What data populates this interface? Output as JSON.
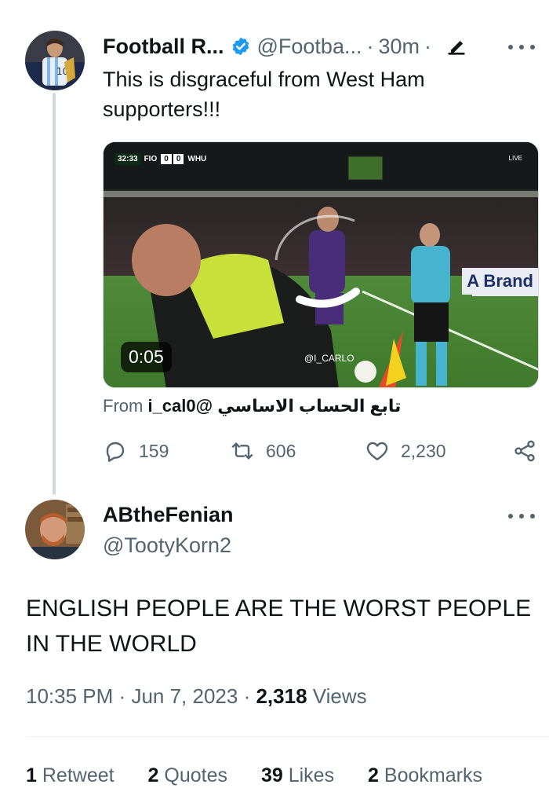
{
  "quoted_tweet": {
    "display_name": "Football R...",
    "handle": "@Footba...",
    "separator": "·",
    "time": "30m",
    "text": "This is disgraceful from West Ham supporters!!!",
    "video": {
      "duration": "0:05",
      "scoreboard": {
        "clock": "32:33",
        "home": "FIO",
        "home_score": "0",
        "away_score": "0",
        "away": "WHU"
      },
      "watermark": "@I_CARLO",
      "broadcaster": "LIVE",
      "board_text": "A Brand"
    },
    "from_label": "From",
    "from_source": "تابع الحساب الاساسي @i_cal0",
    "actions": {
      "replies": "159",
      "retweets": "606",
      "likes": "2,230"
    }
  },
  "main_tweet": {
    "display_name": "ABtheFenian",
    "handle": "@TootyKorn2",
    "text": "ENGLISH PEOPLE ARE THE WORST PEOPLE IN THE WORLD",
    "time": "10:35 PM",
    "date": "Jun 7, 2023",
    "separator": "·",
    "views_count": "2,318",
    "views_label": "Views",
    "stats": [
      {
        "count": "1",
        "label": "Retweet"
      },
      {
        "count": "2",
        "label": "Quotes"
      },
      {
        "count": "39",
        "label": "Likes"
      },
      {
        "count": "2",
        "label": "Bookmarks"
      }
    ]
  },
  "colors": {
    "verified": "#1d9bf0",
    "muted_text": "#536471",
    "primary_text": "#0f1419",
    "thread_line": "#cfd9de"
  }
}
